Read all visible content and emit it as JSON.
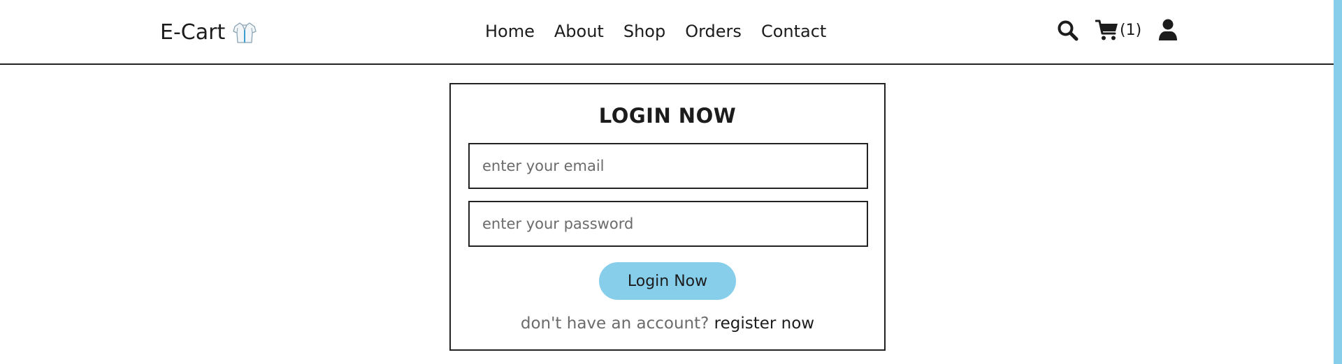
{
  "header": {
    "logo_text": "E-Cart",
    "nav": [
      {
        "label": "Home"
      },
      {
        "label": "About"
      },
      {
        "label": "Shop"
      },
      {
        "label": "Orders"
      },
      {
        "label": "Contact"
      }
    ],
    "icons": {
      "search": "search-icon",
      "cart": "cart-icon",
      "user": "user-icon",
      "logo": "shirt-icon"
    },
    "cart_count": "(1)"
  },
  "login_form": {
    "title": "LOGIN NOW",
    "email_placeholder": "enter your email",
    "email_value": "",
    "password_placeholder": "enter your password",
    "password_value": "",
    "submit_label": "Login Now",
    "register_prompt": "don't have an account?",
    "register_link": "register now"
  },
  "colors": {
    "accent": "#87ceeb",
    "text": "#1c1c1c",
    "muted": "#6b6b6b",
    "border": "#222222"
  }
}
